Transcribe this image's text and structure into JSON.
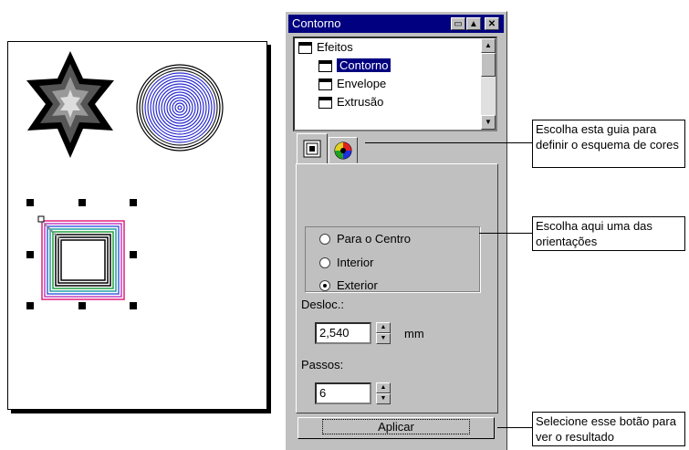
{
  "docker": {
    "title": "Contorno",
    "tree": {
      "root": "Efeitos",
      "items": [
        "Contorno",
        "Envelope",
        "Extrusão"
      ],
      "selected": "Contorno"
    },
    "tabs": [
      {
        "icon": "contour-concentric-squares-icon"
      },
      {
        "icon": "color-wheel-icon"
      }
    ],
    "options": [
      {
        "label": "Para o Centro",
        "checked": false
      },
      {
        "label": "Interior",
        "checked": false
      },
      {
        "label": "Exterior",
        "checked": true
      }
    ],
    "offset": {
      "label": "Desloc.:",
      "value": "2,540",
      "unit": "mm"
    },
    "steps": {
      "label": "Passos:",
      "value": "6"
    },
    "apply_label": "Aplicar"
  },
  "callouts": {
    "color_tab": "Escolha esta guia para definir o esquema de cores",
    "orientation": "Escolha aqui uma das orientações",
    "apply": "Selecione esse botão para ver o resultado"
  },
  "colors": {
    "title_bar": "#000080",
    "dialog": "#c0c0c0",
    "circle_lines": "#2a2ad0"
  }
}
